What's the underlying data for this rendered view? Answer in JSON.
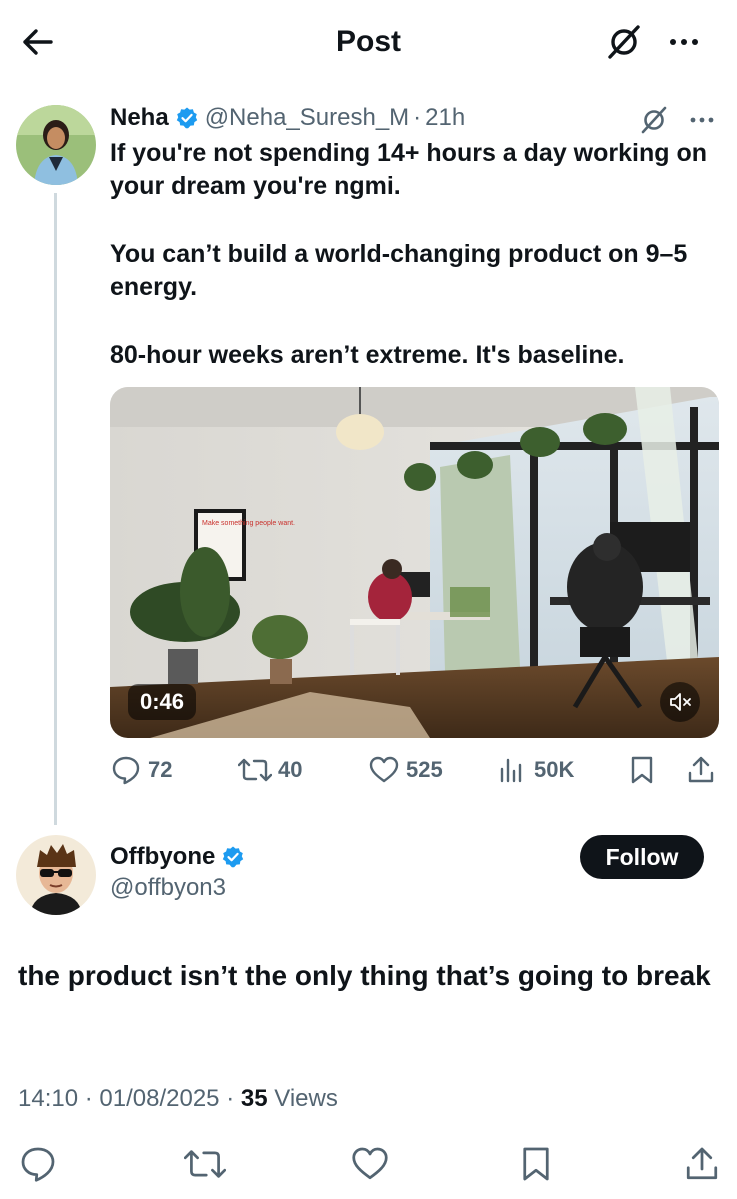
{
  "header": {
    "title": "Post"
  },
  "quoted_post": {
    "author_name": "Neha",
    "handle": "@Neha_Suresh_M",
    "separator": "·",
    "time": "21h",
    "text": [
      "If you're not spending 14+ hours a day working on your dream you're ngmi.",
      "You can’t build a world-changing product on 9–5 energy.",
      "80-hour weeks aren’t extreme. It's baseline."
    ],
    "media": {
      "duration": "0:46",
      "poster_text": "Make something people want."
    },
    "actions": {
      "replies": "72",
      "reposts": "40",
      "likes": "525",
      "views": "50K"
    }
  },
  "reply_post": {
    "author_name": "Offbyone",
    "handle": "@offbyon3",
    "follow_label": "Follow",
    "text": "the product isn’t the only thing that’s going to break",
    "time": "14:10",
    "sep1": "·",
    "date": "01/08/2025",
    "sep2": "·",
    "views_count": "35",
    "views_label": "Views"
  },
  "colors": {
    "text": "#0f1419",
    "muted": "#536471",
    "verified": "#1d9bf0",
    "thread_line": "#cfd9de",
    "follow_bg": "#0f1419"
  },
  "icons": {
    "back": "arrow-left-icon",
    "grok": "grok-icon",
    "more": "more-horizontal-icon",
    "reply": "chat-bubble-icon",
    "repost": "repost-icon",
    "like": "heart-icon",
    "views": "bar-chart-icon",
    "bookmark": "bookmark-icon",
    "share": "share-icon",
    "mute": "speaker-muted-icon"
  }
}
